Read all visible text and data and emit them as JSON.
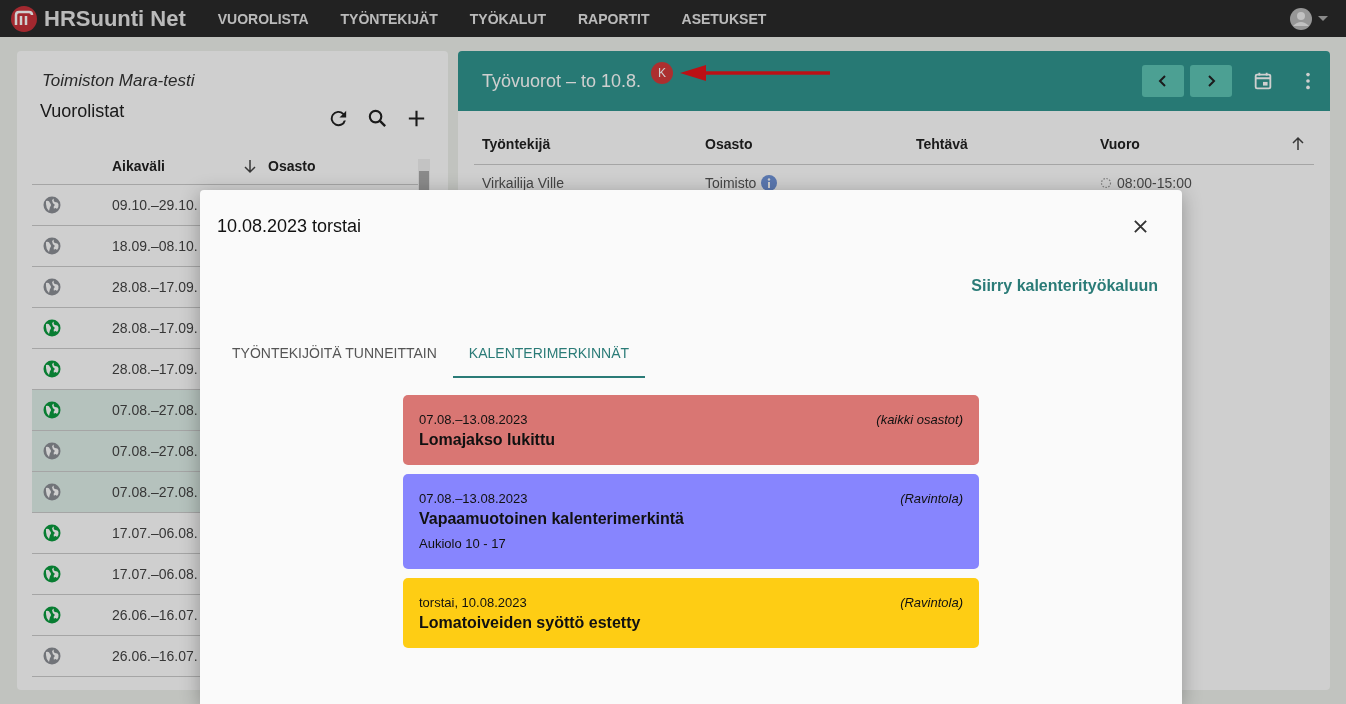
{
  "app": {
    "name": "HRSuunti Net",
    "nav": [
      {
        "label": "VUOROLISTA"
      },
      {
        "label": "TYÖNTEKIJÄT"
      },
      {
        "label": "TYÖKALUT"
      },
      {
        "label": "RAPORTIT"
      },
      {
        "label": "ASETUKSET"
      }
    ]
  },
  "left_panel": {
    "subtitle": "Toimiston Mara-testi",
    "title": "Vuorolistat",
    "columns": [
      "Aikaväli",
      "Osasto"
    ],
    "rows": [
      {
        "period": "09.10.–29.10.",
        "published": false,
        "selected": false
      },
      {
        "period": "18.09.–08.10.",
        "published": false,
        "selected": false
      },
      {
        "period": "28.08.–17.09.",
        "published": false,
        "selected": false
      },
      {
        "period": "28.08.–17.09.",
        "published": true,
        "selected": false
      },
      {
        "period": "28.08.–17.09.",
        "published": true,
        "selected": false
      },
      {
        "period": "07.08.–27.08.",
        "published": true,
        "selected": true
      },
      {
        "period": "07.08.–27.08.",
        "published": false,
        "selected": true
      },
      {
        "period": "07.08.–27.08.",
        "published": false,
        "selected": true
      },
      {
        "period": "17.07.–06.08.",
        "published": true,
        "selected": false
      },
      {
        "period": "17.07.–06.08.",
        "published": true,
        "selected": false
      },
      {
        "period": "26.06.–16.07.",
        "published": true,
        "selected": false
      },
      {
        "period": "26.06.–16.07.",
        "published": false,
        "selected": false
      }
    ]
  },
  "right_panel": {
    "title": "Työvuorot – to 10.8.",
    "badge": "K",
    "columns": [
      "Työntekijä",
      "Osasto",
      "Tehtävä",
      "Vuoro"
    ],
    "rows": [
      {
        "employee": "Virkailija Ville",
        "department": "Toimisto",
        "shift": "08:00-15:00"
      }
    ]
  },
  "dialog": {
    "title": "10.08.2023 torstai",
    "link": "Siirry kalenterityökaluun",
    "tabs": [
      {
        "label": "TYÖNTEKIJÖITÄ TUNNEITTAIN",
        "selected": false
      },
      {
        "label": "KALENTERIMERKINNÄT",
        "selected": true
      }
    ],
    "entries": [
      {
        "dates": "07.08.–13.08.2023",
        "scope": "(kaikki osastot)",
        "title": "Lomajakso lukittu",
        "color": "#d97673"
      },
      {
        "dates": "07.08.–13.08.2023",
        "scope": "(Ravintola)",
        "title": "Vapaamuotoinen kalenterimerkintä",
        "note": "Aukiolo 10 - 17",
        "color": "#8785fe"
      },
      {
        "dates": "torstai, 10.08.2023",
        "scope": "(Ravintola)",
        "title": "Lomatoiveiden syöttö estetty",
        "color": "#fecd14"
      }
    ]
  }
}
